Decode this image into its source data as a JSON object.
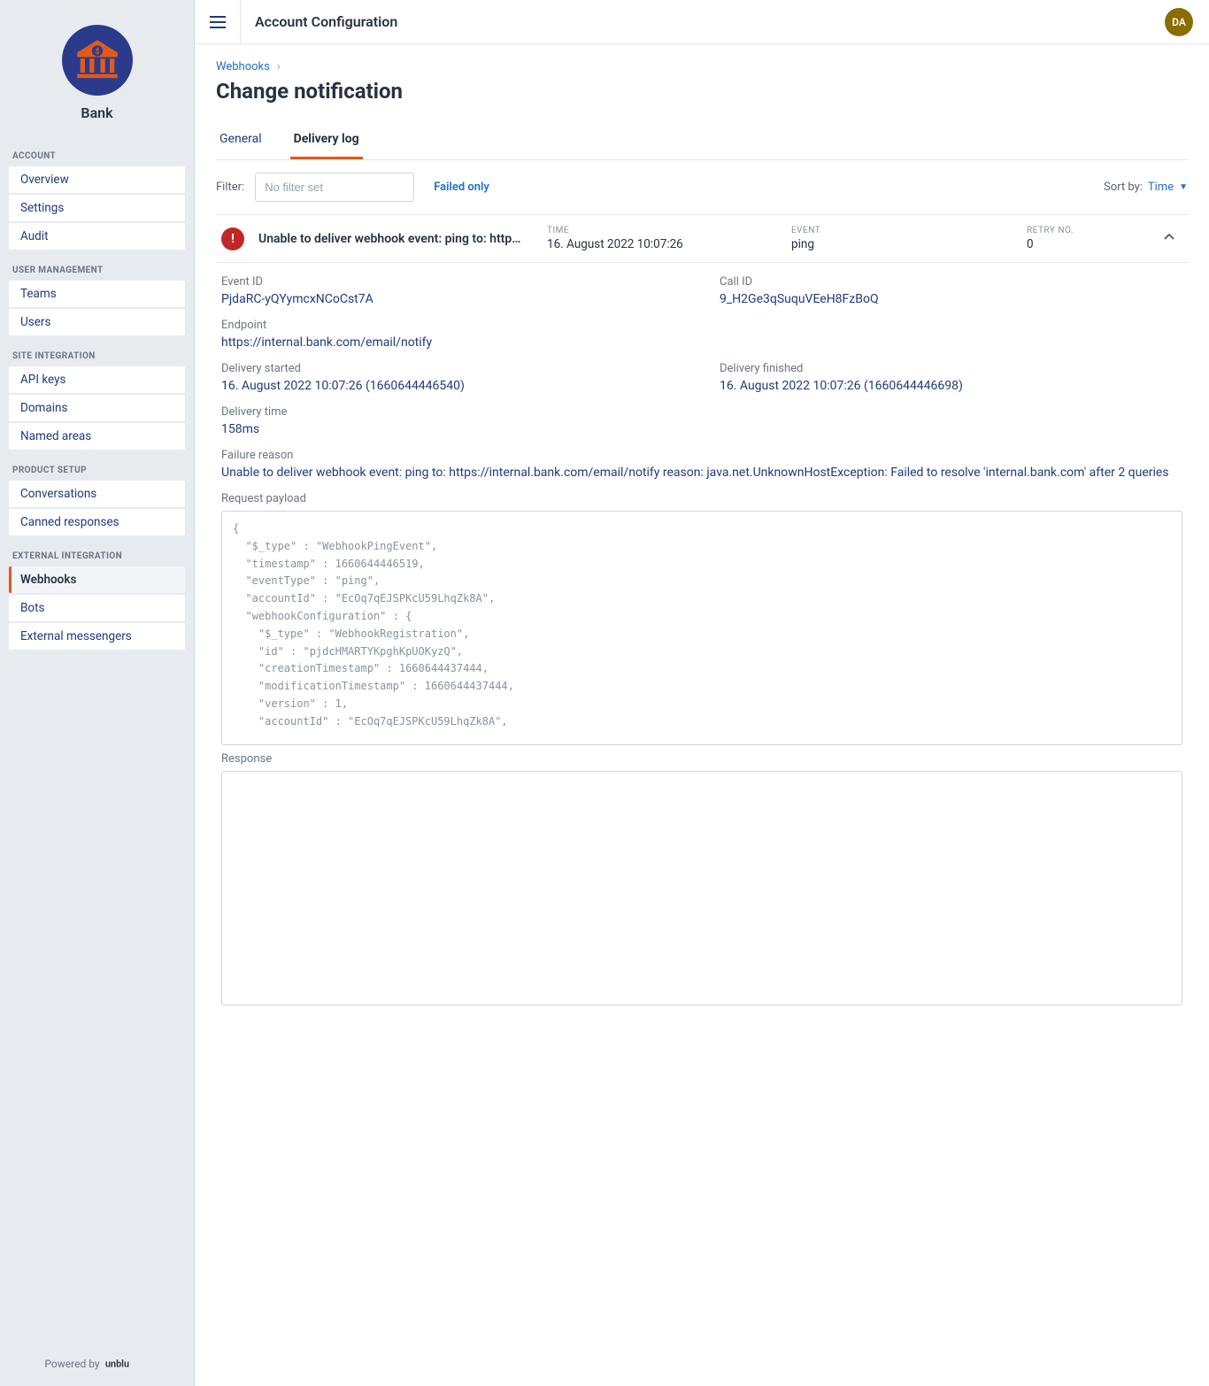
{
  "brand": {
    "name": "Bank"
  },
  "sidebar": {
    "sections": [
      {
        "title": "ACCOUNT",
        "items": [
          "Overview",
          "Settings",
          "Audit"
        ]
      },
      {
        "title": "USER MANAGEMENT",
        "items": [
          "Teams",
          "Users"
        ]
      },
      {
        "title": "SITE INTEGRATION",
        "items": [
          "API keys",
          "Domains",
          "Named areas"
        ]
      },
      {
        "title": "PRODUCT SETUP",
        "items": [
          "Conversations",
          "Canned responses"
        ]
      },
      {
        "title": "EXTERNAL INTEGRATION",
        "items": [
          "Webhooks",
          "Bots",
          "External messengers"
        ]
      }
    ],
    "active": "Webhooks",
    "footer": "Powered by"
  },
  "topbar": {
    "title": "Account Configuration",
    "avatar": "DA"
  },
  "breadcrumb": {
    "root": "Webhooks"
  },
  "page": {
    "title": "Change notification"
  },
  "tabs": {
    "items": [
      "General",
      "Delivery log"
    ],
    "active": "Delivery log"
  },
  "filter": {
    "label": "Filter:",
    "placeholder": "No filter set",
    "failed_only": "Failed only"
  },
  "sort": {
    "label": "Sort by:",
    "value": "Time"
  },
  "log": {
    "message": "Unable to deliver webhook event: ping to: http…",
    "time_label": "TIME",
    "time": "16. August 2022 10:07:26",
    "event_label": "EVENT",
    "event": "ping",
    "retry_label": "RETRY NO.",
    "retry": "0"
  },
  "detail": {
    "event_id_lbl": "Event ID",
    "event_id": "PjdaRC-yQYymcxNCoCst7A",
    "call_id_lbl": "Call ID",
    "call_id": "9_H2Ge3qSuquVEeH8FzBoQ",
    "endpoint_lbl": "Endpoint",
    "endpoint": "https://internal.bank.com/email/notify",
    "started_lbl": "Delivery started",
    "started": "16. August 2022 10:07:26 (1660644446540)",
    "finished_lbl": "Delivery finished",
    "finished": "16. August 2022 10:07:26 (1660644446698)",
    "time_lbl": "Delivery time",
    "time": "158ms",
    "reason_lbl": "Failure reason",
    "reason": "Unable to deliver webhook event: ping to: https://internal.bank.com/email/notify reason: java.net.UnknownHostException: Failed to resolve 'internal.bank.com' after 2 queries",
    "request_lbl": "Request payload",
    "request_payload": "{\n  \"$_type\" : \"WebhookPingEvent\",\n  \"timestamp\" : 1660644446519,\n  \"eventType\" : \"ping\",\n  \"accountId\" : \"EcOq7qEJSPKcU59LhqZk8A\",\n  \"webhookConfiguration\" : {\n    \"$_type\" : \"WebhookRegistration\",\n    \"id\" : \"pjdcHMARTYKpghKpUOKyzQ\",\n    \"creationTimestamp\" : 1660644437444,\n    \"modificationTimestamp\" : 1660644437444,\n    \"version\" : 1,\n    \"accountId\" : \"EcOq7qEJSPKcU59LhqZk8A\",",
    "response_lbl": "Response"
  }
}
